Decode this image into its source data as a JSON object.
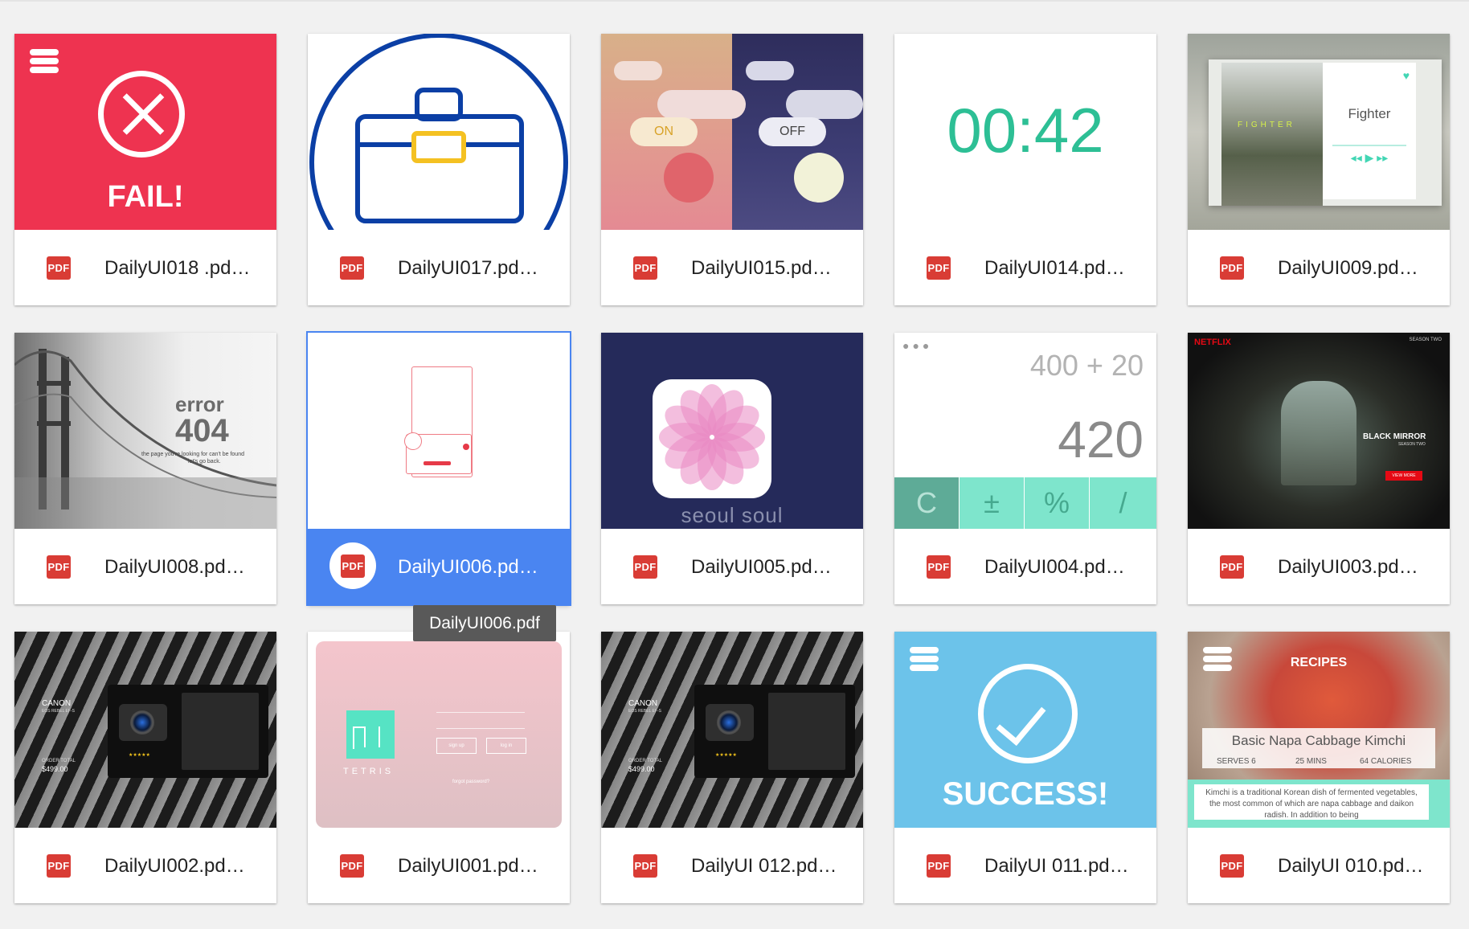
{
  "files": [
    {
      "name": "DailyUI018 .pd…",
      "type_label": "PDF"
    },
    {
      "name": "DailyUI017.pd…",
      "type_label": "PDF"
    },
    {
      "name": "DailyUI015.pd…",
      "type_label": "PDF"
    },
    {
      "name": "DailyUI014.pd…",
      "type_label": "PDF"
    },
    {
      "name": "DailyUI009.pd…",
      "type_label": "PDF"
    },
    {
      "name": "DailyUI008.pd…",
      "type_label": "PDF"
    },
    {
      "name": "DailyUI006.pd…",
      "type_label": "PDF"
    },
    {
      "name": "DailyUI005.pd…",
      "type_label": "PDF"
    },
    {
      "name": "DailyUI004.pd…",
      "type_label": "PDF"
    },
    {
      "name": "DailyUI003.pd…",
      "type_label": "PDF"
    },
    {
      "name": "DailyUI002.pd…",
      "type_label": "PDF"
    },
    {
      "name": "DailyUI001.pd…",
      "type_label": "PDF"
    },
    {
      "name": "DailyUI 012.pd…",
      "type_label": "PDF"
    },
    {
      "name": "DailyUI 011.pd…",
      "type_label": "PDF"
    },
    {
      "name": "DailyUI 010.pd…",
      "type_label": "PDF"
    }
  ],
  "selected_tooltip": "DailyUI006.pdf",
  "thumbs": {
    "fail": {
      "text": "FAIL!"
    },
    "toggle": {
      "on": "ON",
      "off": "OFF"
    },
    "timer": {
      "text": "00:42"
    },
    "music": {
      "title": "Fighter",
      "poster": "FIGHTER"
    },
    "error": {
      "word": "error",
      "code": "404",
      "msg": "the page you're looking for can't be found",
      "back": "let's go back."
    },
    "app": {
      "text": "seoul soul"
    },
    "calc": {
      "expr": "400 + 20",
      "result": "420",
      "keys": [
        "C",
        "±",
        "%",
        "/"
      ]
    },
    "netflix": {
      "brand": "NETFLIX",
      "season": "SEASON TWO",
      "title": "BLACK MIRROR",
      "sub": "SEASON TWO",
      "cta": "VIEW MORE"
    },
    "checkout": {
      "brand": "CANON",
      "model": "EOS REBEL EF-S",
      "total_label": "ORDER TOTAL",
      "total": "$499.00"
    },
    "login": {
      "logo": "TETRIS",
      "signup": "sign up",
      "login": "log in",
      "forgot": "forgot password?"
    },
    "success": {
      "text": "SUCCESS!"
    },
    "recipe": {
      "header": "RECIPES",
      "title": "Basic Napa Cabbage Kimchi",
      "serves": "SERVES 6",
      "time": "25 MINS",
      "cal": "64 CALORIES",
      "desc": "Kimchi is a traditional Korean dish of fermented vegetables, the most common of which are napa cabbage and daikon radish. In addition to being"
    }
  },
  "colors": {
    "selected": "#4a85f1",
    "pdf_red": "#d93c35",
    "fail_red": "#ee3350",
    "success_blue": "#6cc3ea",
    "timer_green": "#2dbf95",
    "mint": "#7ee5cc"
  }
}
